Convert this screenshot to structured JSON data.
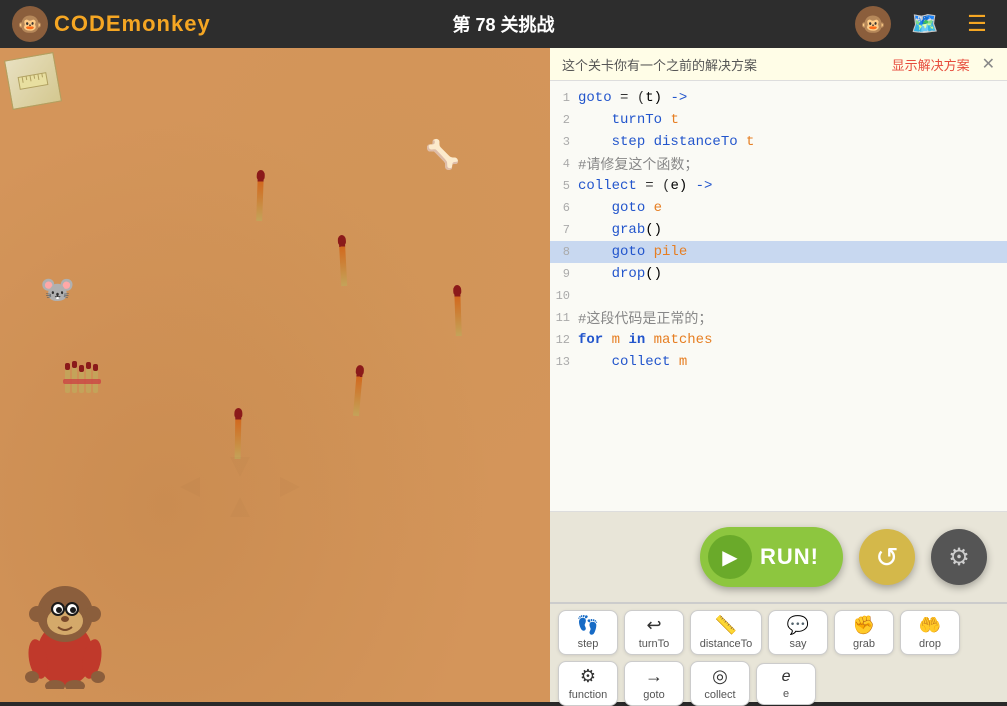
{
  "header": {
    "title": "第 78 关挑战",
    "logo_text": "CODEmonkey",
    "logo_emoji": "🐵",
    "map_emoji": "🗺️",
    "menu_symbol": "☰",
    "avatar_emoji": "🐵"
  },
  "banner": {
    "text": "这个关卡你有一个之前的解决方案",
    "link_text": "显示解决方案",
    "close_symbol": "✕"
  },
  "code": {
    "lines": [
      {
        "num": "1",
        "content": "goto = (t) ->",
        "highlight": false
      },
      {
        "num": "2",
        "content": "    turnTo t",
        "highlight": false
      },
      {
        "num": "3",
        "content": "    step distanceTo t",
        "highlight": false
      },
      {
        "num": "4",
        "content": "#请修复这个函数；",
        "highlight": false
      },
      {
        "num": "5",
        "content": "collect = (e) ->",
        "highlight": false
      },
      {
        "num": "6",
        "content": "    goto e",
        "highlight": false
      },
      {
        "num": "7",
        "content": "    grab()",
        "highlight": false
      },
      {
        "num": "8",
        "content": "    goto pile",
        "highlight": true
      },
      {
        "num": "9",
        "content": "    drop()",
        "highlight": false
      },
      {
        "num": "10",
        "content": "",
        "highlight": false
      },
      {
        "num": "11",
        "content": "#这段代码是正常的；",
        "highlight": false
      },
      {
        "num": "12",
        "content": "for m in matches",
        "highlight": false
      },
      {
        "num": "13",
        "content": "    collect m",
        "highlight": false
      }
    ]
  },
  "run_button": {
    "label": "RUN!",
    "play_symbol": "▶"
  },
  "reset_symbol": "↺",
  "settings_symbol": "⚙",
  "toolbar": {
    "row1": [
      {
        "icon": "👣",
        "label": "step"
      },
      {
        "icon": "↩️",
        "label": "turnTo"
      },
      {
        "icon": "📏",
        "label": "distanceTo"
      },
      {
        "icon": "💬",
        "label": "say"
      },
      {
        "icon": "✊",
        "label": "grab"
      },
      {
        "icon": "🤲",
        "label": "drop"
      }
    ],
    "row2": [
      {
        "icon": "⚙→",
        "label": "function"
      },
      {
        "icon": "→",
        "label": "goto"
      },
      {
        "icon": "◉",
        "label": "collect"
      },
      {
        "icon": "e",
        "label": "e"
      }
    ]
  }
}
